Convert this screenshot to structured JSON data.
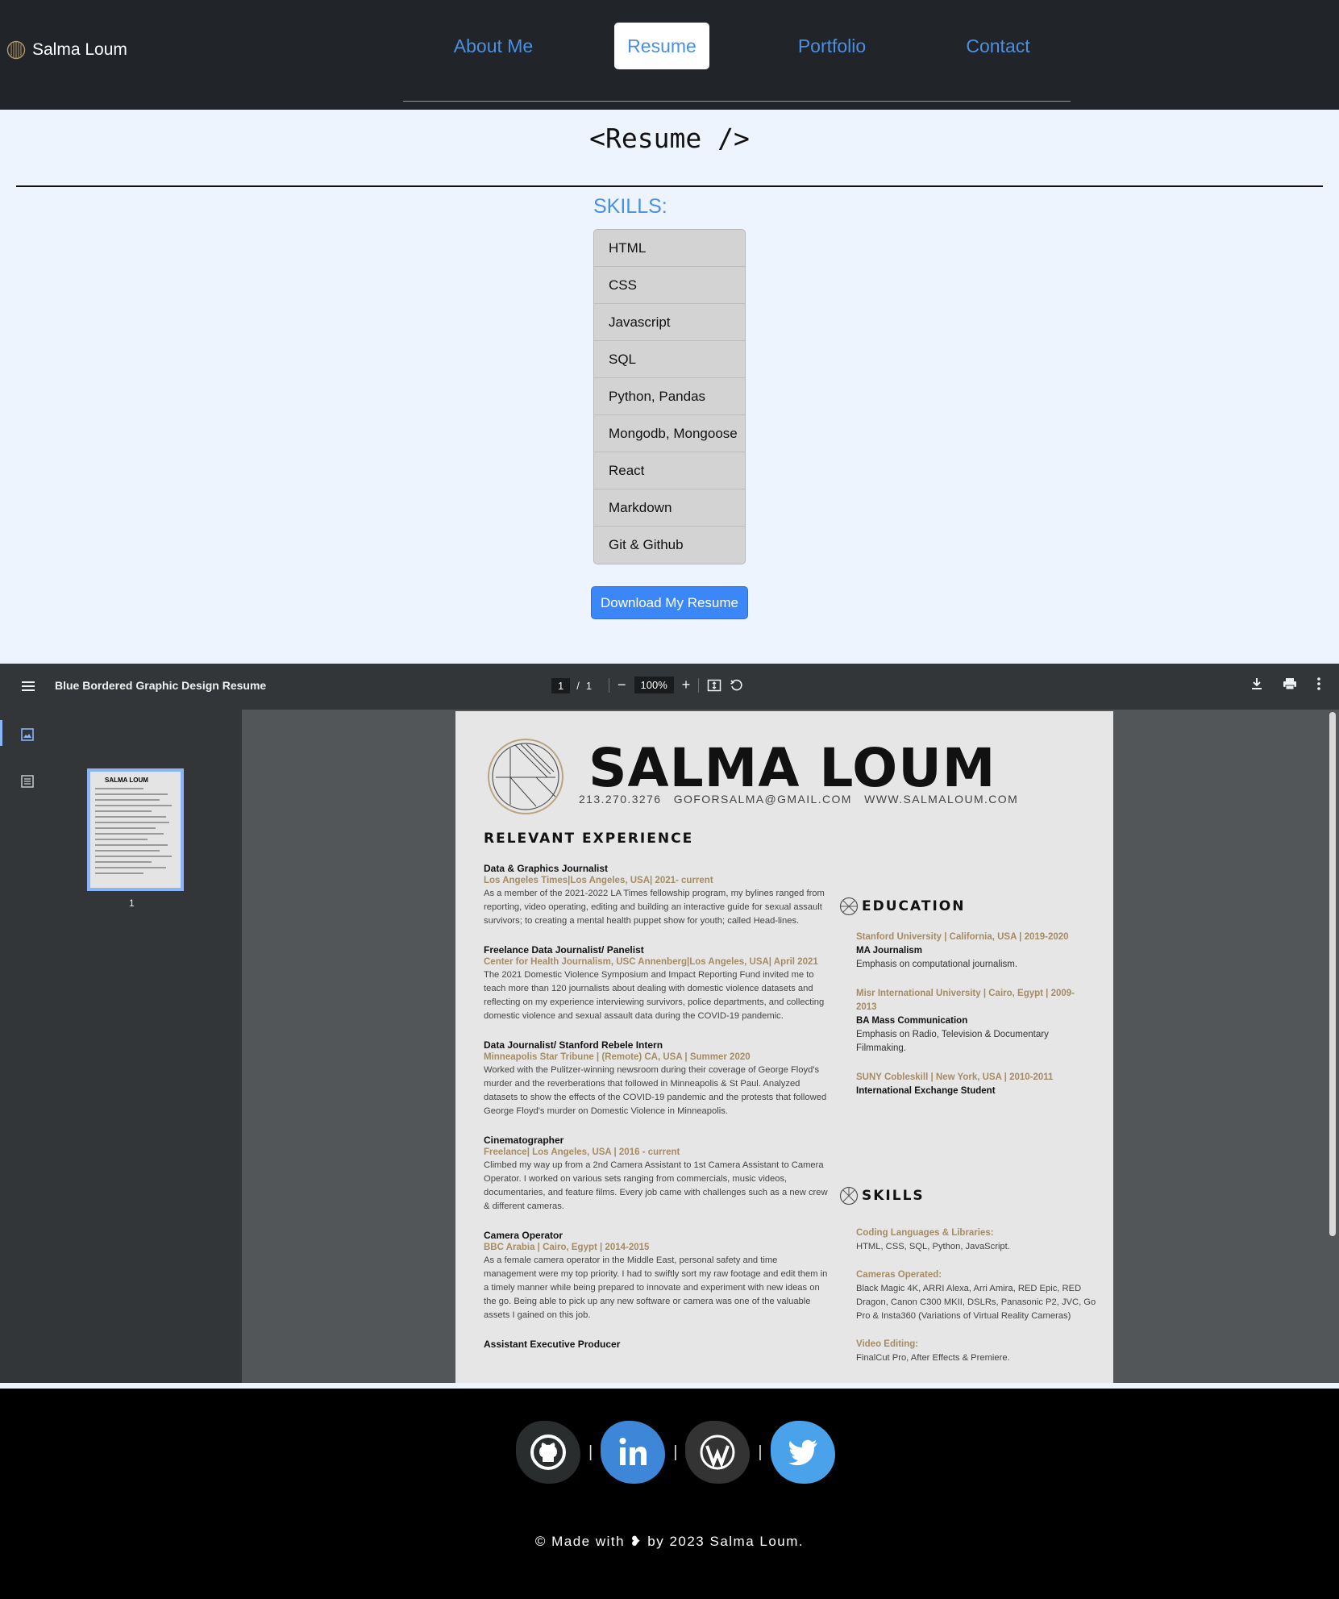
{
  "header": {
    "brand_name": "Salma Loum",
    "nav": [
      {
        "label": "About Me",
        "active": false
      },
      {
        "label": "Resume",
        "active": true
      },
      {
        "label": "Portfolio",
        "active": false
      },
      {
        "label": "Contact",
        "active": false
      }
    ],
    "accent_color": "#4a90e2"
  },
  "main": {
    "title": "<Resume />",
    "skills_heading": "SKILLS:",
    "skills": [
      "HTML",
      "CSS",
      "Javascript",
      "SQL",
      "Python, Pandas",
      "Mongodb, Mongoose",
      "React",
      "Markdown",
      "Git & Github"
    ],
    "download_label": "Download My Resume"
  },
  "pdf_viewer": {
    "document_title": "Blue Bordered Graphic Design Resume",
    "current_page": "1",
    "page_separator": "/",
    "total_pages": "1",
    "zoom": "100%",
    "thumbnail_page": "1",
    "icons": {
      "menu": "menu-icon",
      "zoom_out": "minus-icon",
      "zoom_in": "plus-icon",
      "fit": "fit-page-icon",
      "rotate": "rotate-icon",
      "download": "download-icon",
      "print": "print-icon",
      "more": "more-vert-icon",
      "thumbnails": "image-icon",
      "outline": "outline-icon"
    },
    "resume": {
      "name": "SALMA LOUM",
      "contact": "213.270.3276    GOFORSALMA@GMAIL.COM    WWW.SALMALOUM.COM",
      "experience_heading": "RELEVANT EXPERIENCE",
      "jobs": [
        {
          "title": "Data & Graphics Journalist",
          "org": "Los Angeles Times|Los Angeles, USA| 2021- current",
          "desc": "As a member of the 2021-2022 LA Times fellowship program, my bylines ranged from reporting, video operating, editing and building an interactive guide for sexual assault survivors; to creating a mental health puppet show for youth; called Head-lines."
        },
        {
          "title": "Freelance Data Journalist/ Panelist",
          "org": "Center for Health Journalism, USC Annenberg|Los Angeles, USA| April 2021",
          "desc": "The 2021 Domestic Violence Symposium and Impact Reporting Fund invited me to teach more than 120 journalists about dealing with domestic violence datasets and reflecting on my experience interviewing survivors, police departments, and collecting domestic violence and sexual assault data during the COVID-19 pandemic."
        },
        {
          "title": "Data Journalist/ Stanford Rebele Intern",
          "org": "Minneapolis Star Tribune | (Remote) CA, USA | Summer 2020",
          "desc": "Worked with the Pulitzer-winning newsroom during their coverage of George Floyd's murder and the reverberations that followed in Minneapolis & St Paul. Analyzed datasets to show the effects of the COVID-19 pandemic and the protests that followed George Floyd's murder on Domestic Violence in Minneapolis."
        },
        {
          "title": "Cinematographer",
          "org": "Freelance| Los Angeles, USA | 2016 - current",
          "desc": "Climbed my way up from a 2nd Camera Assistant to 1st Camera Assistant to Camera Operator. I worked on various sets ranging from commercials, music videos, documentaries, and feature films. Every job came with challenges such as a new crew  & different cameras."
        },
        {
          "title": "Camera Operator",
          "org": "BBC Arabia | Cairo, Egypt | 2014-2015",
          "desc": "As a female camera operator in the Middle East,  personal safety and time management were my top priority.  I had to swiftly sort my raw footage and edit them in a timely manner while being prepared to innovate and experiment with new   ideas on the go. Being able to pick up any new software or camera was one of the valuable assets I gained on this job."
        },
        {
          "title": "Assistant Executive Producer",
          "org": "",
          "desc": ""
        }
      ],
      "education_heading": "EDUCATION",
      "education": [
        {
          "school": "Stanford University | California, USA | 2019-2020",
          "degree": "MA Journalism",
          "desc": "Emphasis on computational journalism."
        },
        {
          "school": "Misr International University | Cairo, Egypt | 2009-2013",
          "degree": "BA Mass Communication",
          "desc": "Emphasis on Radio, Television & Documentary Filmmaking."
        },
        {
          "school": "SUNY Cobleskill | New York, USA | 2010-2011",
          "degree": "International Exchange Student",
          "desc": ""
        }
      ],
      "skills_heading": "SKILLS",
      "skills": [
        {
          "label": "Coding Languages & Libraries:",
          "text": "HTML, CSS, SQL, Python, JavaScript."
        },
        {
          "label": "Cameras Operated:",
          "text": "Black Magic 4K, ARRI Alexa, Arri Amira, RED  Epic, RED Dragon, Canon C300 MKII, DSLRs, Panasonic  P2, JVC,  Go Pro & Insta360 (Variations of Virtual Reality Cameras)"
        },
        {
          "label": "Video Editing:",
          "text": "FinalCut Pro, After Effects & Premiere."
        }
      ]
    }
  },
  "footer": {
    "social": [
      "github-icon",
      "linkedin-icon",
      "wordpress-icon",
      "twitter-icon"
    ],
    "separator": "|",
    "copyright": "© Made with ❥ by 2023 Salma Loum."
  }
}
